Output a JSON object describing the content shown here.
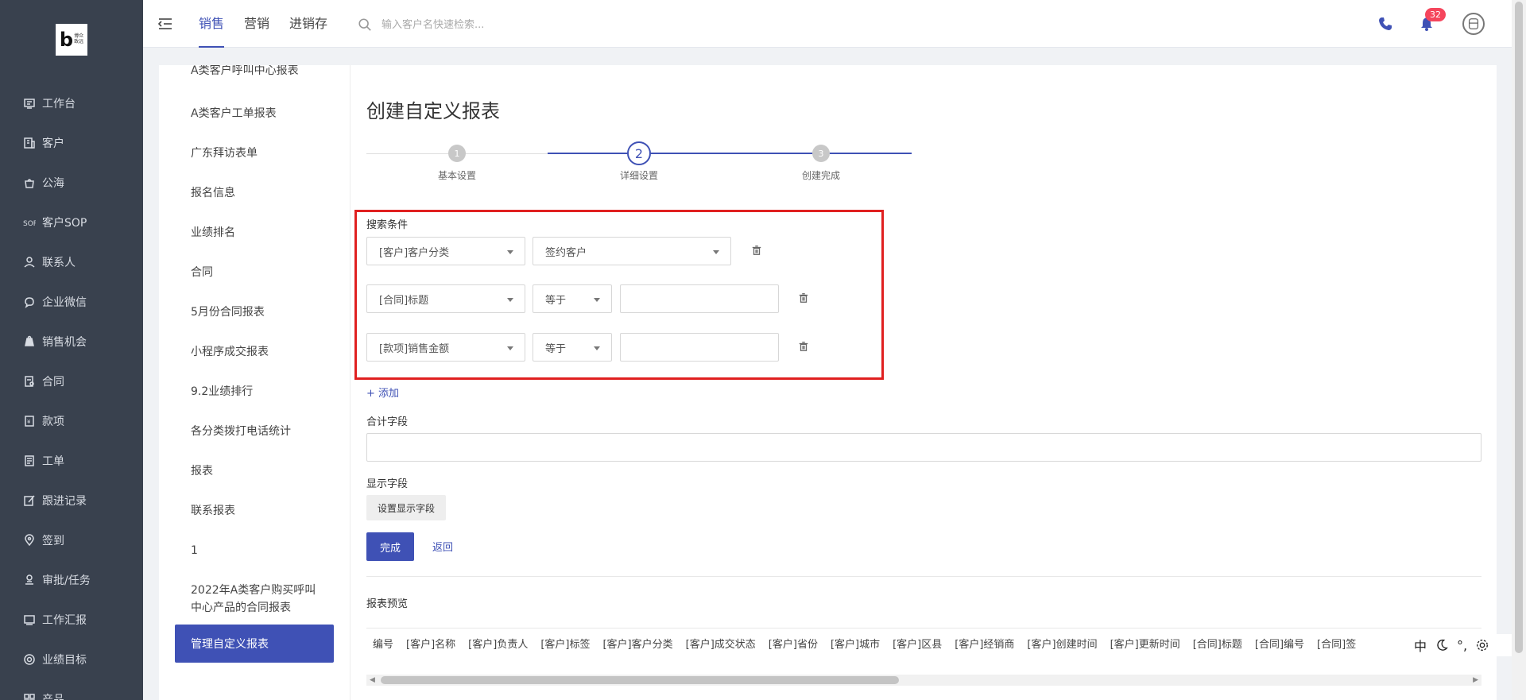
{
  "logo": {
    "letter": "b",
    "text": "博众\n致远"
  },
  "sidebar": {
    "items": [
      {
        "label": "工作台",
        "icon": "workbench-icon"
      },
      {
        "label": "客户",
        "icon": "building-icon"
      },
      {
        "label": "公海",
        "icon": "pool-icon"
      },
      {
        "label": "客户SOP",
        "icon": "sop-icon"
      },
      {
        "label": "联系人",
        "icon": "contact-icon"
      },
      {
        "label": "企业微信",
        "icon": "wechat-icon"
      },
      {
        "label": "销售机会",
        "icon": "money-bag-icon"
      },
      {
        "label": "合同",
        "icon": "contract-icon"
      },
      {
        "label": "款项",
        "icon": "payment-icon"
      },
      {
        "label": "工单",
        "icon": "ticket-icon"
      },
      {
        "label": "跟进记录",
        "icon": "edit-icon"
      },
      {
        "label": "签到",
        "icon": "location-icon"
      },
      {
        "label": "审批/任务",
        "icon": "approval-icon"
      },
      {
        "label": "工作汇报",
        "icon": "report-icon"
      },
      {
        "label": "业绩目标",
        "icon": "target-icon"
      },
      {
        "label": "产品",
        "icon": "product-icon"
      }
    ]
  },
  "topbar": {
    "tabs": [
      "销售",
      "营销",
      "进销存"
    ],
    "active_tab": 0,
    "search_placeholder": "输入客户名快速检索...",
    "notification_count": "32"
  },
  "report_list": {
    "items": [
      "A类客户呼叫中心报表",
      "A类客户工单报表",
      "广东拜访表单",
      "报名信息",
      "业绩排名",
      "合同",
      "5月份合同报表",
      "小程序成交报表",
      "9.2业绩排行",
      "各分类拨打电话统计",
      "报表",
      "联系报表",
      "1",
      "2022年A类客户购买呼叫中心产品的合同报表"
    ],
    "active_item": "管理自定义报表"
  },
  "main": {
    "title": "创建自定义报表",
    "steps": [
      {
        "num": "1",
        "label": "基本设置"
      },
      {
        "num": "2",
        "label": "详细设置"
      },
      {
        "num": "3",
        "label": "创建完成"
      }
    ],
    "current_step": 2,
    "search_conditions_label": "搜索条件",
    "conditions": [
      {
        "field": "[客户]客户分类",
        "value": "签约客户"
      },
      {
        "field": "[合同]标题",
        "operator": "等于",
        "value": ""
      },
      {
        "field": "[款项]销售金额",
        "operator": "等于",
        "value": ""
      }
    ],
    "add_label": "+ 添加",
    "sum_field_label": "合计字段",
    "display_field_label": "显示字段",
    "set_display_button": "设置显示字段",
    "done_button": "完成",
    "back_link": "返回",
    "preview_label": "报表预览",
    "preview_columns": [
      "编号",
      "[客户]名称",
      "[客户]负责人",
      "[客户]标签",
      "[客户]客户分类",
      "[客户]成交状态",
      "[客户]省份",
      "[客户]城市",
      "[客户]区县",
      "[客户]经销商",
      "[客户]创建时间",
      "[客户]更新时间",
      "[合同]标题",
      "[合同]编号",
      "[合同]签"
    ]
  },
  "ime": {
    "lang": "中",
    "punct": "°,"
  },
  "colors": {
    "primary": "#3f51b5",
    "sidebar": "#39414e",
    "highlight": "#e02020",
    "badge": "#f5455c"
  }
}
